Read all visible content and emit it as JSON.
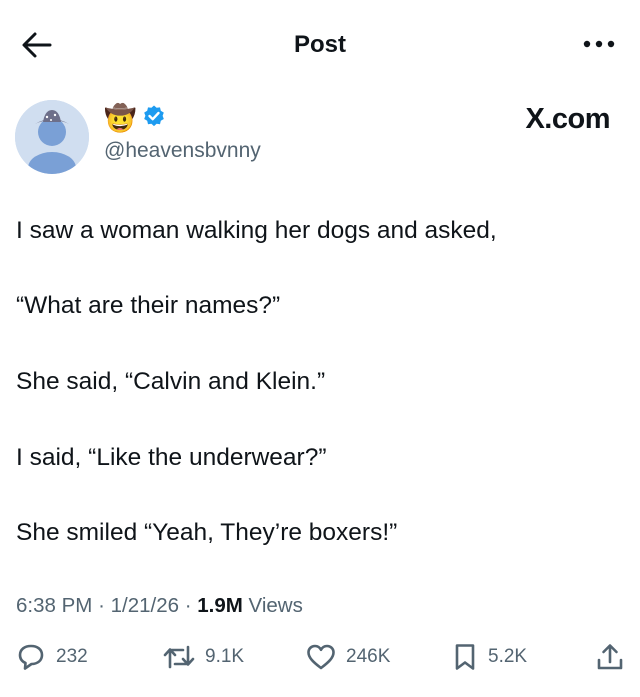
{
  "header": {
    "title": "Post"
  },
  "author": {
    "emoji": "🤠",
    "handle": "@heavensbvnny"
  },
  "source_label": "X.com",
  "tweet": {
    "lines": [
      "I saw a woman walking her dogs and asked,",
      "“What are their names?”",
      "She said, “Calvin and Klein.”",
      "I said, “Like the underwear?”",
      "She smiled “Yeah, They’re boxers!”"
    ]
  },
  "meta": {
    "time": "6:38 PM",
    "date": "1/21/26",
    "views_count": "1.9M",
    "views_label": "Views",
    "separator": "·"
  },
  "actions": {
    "replies": "232",
    "reposts": "9.1K",
    "likes": "246K",
    "bookmarks": "5.2K"
  },
  "colors": {
    "text": "#0f1419",
    "muted": "#536471",
    "verified": "#1d9bf0",
    "avatar_bg": "#d0def0",
    "avatar_figure": "#7aa0d6"
  },
  "icons": [
    "back-arrow-icon",
    "more-icon",
    "verified-badge-icon",
    "reply-icon",
    "repost-icon",
    "like-icon",
    "bookmark-icon",
    "share-icon"
  ]
}
